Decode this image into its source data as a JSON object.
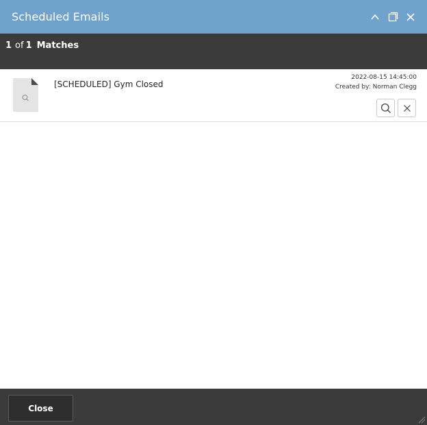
{
  "window": {
    "title": "Scheduled Emails",
    "controls": [
      {
        "icon": "chevron-up-icon"
      },
      {
        "icon": "maximize-icon"
      },
      {
        "icon": "close-icon"
      }
    ]
  },
  "match_bar": {
    "current": "1",
    "of_text": "of",
    "total": "1",
    "label": "Matches"
  },
  "results": [
    {
      "thumbnail_icon": "document-preview-icon",
      "subject": "[SCHEDULED] Gym Closed",
      "date": "2022-08-15 14:45:00",
      "created_by": "Created by: Norman Clegg",
      "actions": [
        {
          "icon": "search-icon"
        },
        {
          "icon": "close-icon"
        }
      ]
    }
  ],
  "footer": {
    "close_label": "Close"
  },
  "colors": {
    "titlebar": "#6fa3cd",
    "dark_bar": "#3b3b3b",
    "button_dark": "#2e2e2e"
  }
}
